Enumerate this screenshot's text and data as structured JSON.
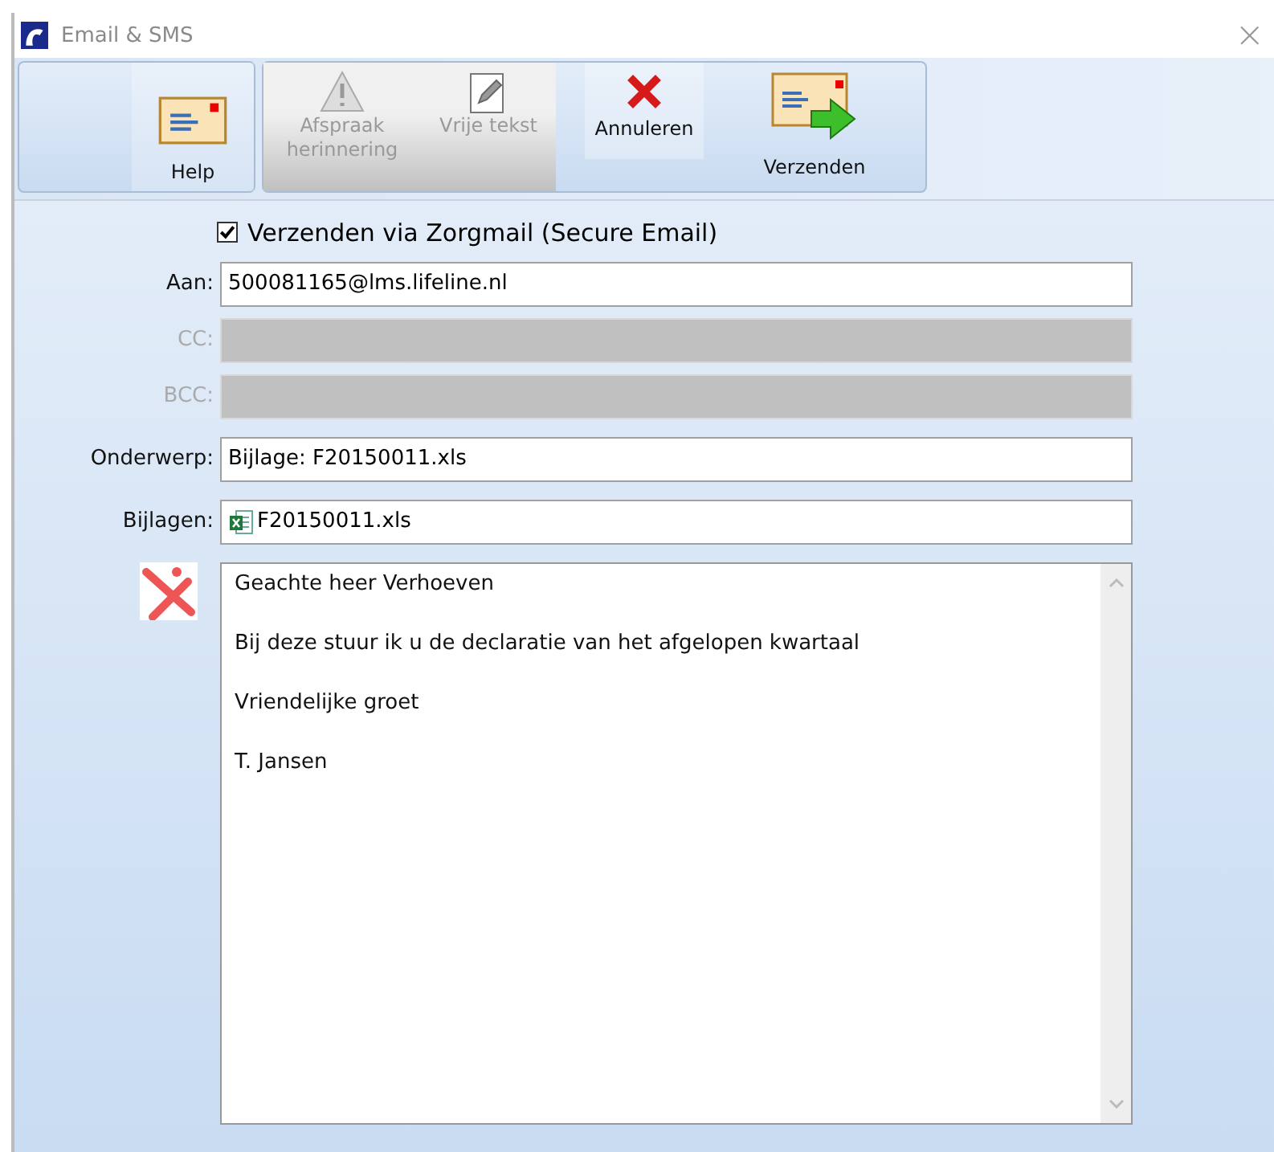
{
  "window": {
    "title": "Email & SMS",
    "close": "×"
  },
  "toolbar_groups": [
    {
      "buttons": [
        {
          "label": "Help",
          "kind": "envelope",
          "disabled": false
        }
      ]
    },
    {
      "buttons": [
        {
          "label": "Afspraak herinnering",
          "kind": "warning",
          "disabled": true
        },
        {
          "label": "Vrije tekst",
          "kind": "pencil",
          "disabled": true
        },
        {
          "label": "Annuleren",
          "kind": "cross",
          "disabled": false
        },
        {
          "label": "Verzenden",
          "kind": "send",
          "disabled": false
        }
      ]
    }
  ],
  "secure_checkbox": {
    "label": "Verzenden via Zorgmail (Secure Email)",
    "checked": true
  },
  "fields": [
    {
      "label": "Aan:",
      "value": "500081165@lms.lifeline.nl",
      "kind": "text",
      "disabled": false
    },
    {
      "label": "CC:",
      "kind": "text",
      "disabled": true
    },
    {
      "label": "BCC:",
      "kind": "text",
      "disabled": true
    },
    {
      "label": "Onderwerp:",
      "value": "Bijlage: F20150011.xls",
      "kind": "text",
      "disabled": false
    },
    {
      "label": "Bijlagen:",
      "value": "F20150011.xls",
      "kind": "attachment",
      "disabled": false
    }
  ],
  "message": {
    "lines": [
      "Geachte heer Verhoeven",
      "Bij deze stuur ik u de declaratie van het afgelopen kwartaal",
      "Vriendelijke groet",
      "T. Jansen"
    ]
  }
}
